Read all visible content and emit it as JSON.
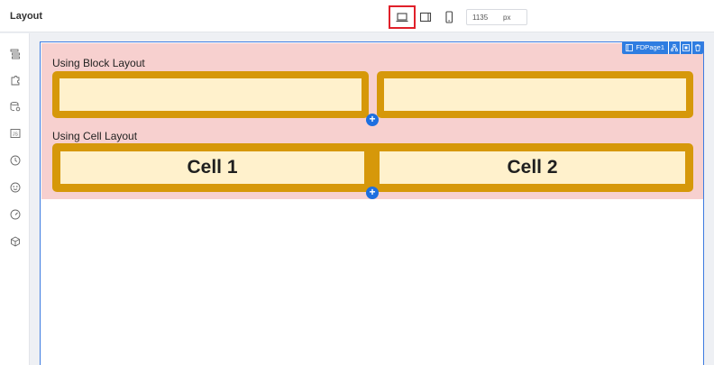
{
  "header": {
    "title": "Layout",
    "width_value": "1135",
    "width_unit": "px",
    "devices": [
      "desktop-icon",
      "tablet-icon",
      "mobile-icon"
    ],
    "active_device": "desktop"
  },
  "sidebar": {
    "icons": [
      "pages-icon",
      "widgets-icon",
      "data-icon",
      "js-icon",
      "history-icon",
      "theme-icon",
      "performance-icon",
      "package-icon"
    ]
  },
  "canvas": {
    "page_name": "FDPage1",
    "sections": [
      {
        "label": "Using Block Layout",
        "items": [
          "",
          ""
        ]
      },
      {
        "label": "Using Cell Layout",
        "items": [
          "Cell 1",
          "Cell 2"
        ]
      }
    ],
    "add_label": "+"
  },
  "colors": {
    "accent": "#2f7de1",
    "selection_highlight": "#e0202a",
    "section_bg": "#f7d0cf",
    "block_border": "#d6980a",
    "block_fill": "#fff1cc"
  }
}
